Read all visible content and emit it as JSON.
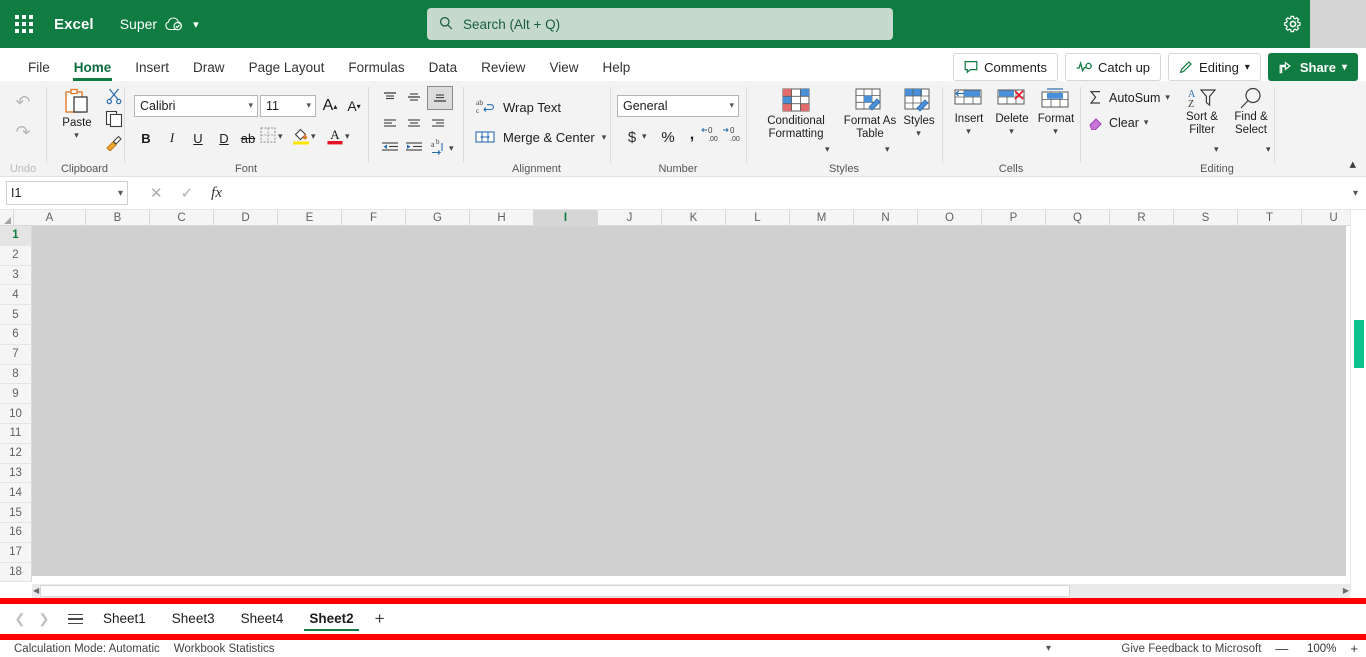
{
  "titlebar": {
    "app_name": "Excel",
    "doc_name": "Super",
    "saved_icon": "cloud-saved-icon",
    "waffle_icon": "app-launcher-icon",
    "gear_icon": "settings-gear-icon",
    "chevron_icon": "chevron-down-icon"
  },
  "search": {
    "placeholder": "Search (Alt + Q)",
    "icon": "search-icon"
  },
  "header_actions": [
    {
      "label": "Comments",
      "icon": "comment-bubble-icon",
      "has_chevron": false,
      "primary": false
    },
    {
      "label": "Catch up",
      "icon": "activity-line-icon",
      "has_chevron": false,
      "primary": false
    },
    {
      "label": "Editing",
      "icon": "pencil-icon",
      "has_chevron": true,
      "primary": false
    },
    {
      "label": "Share",
      "icon": "share-arrow-icon",
      "has_chevron": true,
      "primary": true
    }
  ],
  "ribbon_tabs": [
    {
      "label": "File",
      "active": false
    },
    {
      "label": "Home",
      "active": true
    },
    {
      "label": "Insert",
      "active": false
    },
    {
      "label": "Draw",
      "active": false
    },
    {
      "label": "Page Layout",
      "active": false
    },
    {
      "label": "Formulas",
      "active": false
    },
    {
      "label": "Data",
      "active": false
    },
    {
      "label": "Review",
      "active": false
    },
    {
      "label": "View",
      "active": false
    },
    {
      "label": "Help",
      "active": false
    }
  ],
  "ribbon": {
    "groups": {
      "undo": {
        "label": "Undo",
        "buttons": [
          "undo-arrow-icon",
          "redo-arrow-icon"
        ]
      },
      "clipboard": {
        "label": "Clipboard",
        "paste_label": "Paste",
        "cut_label": "Cut",
        "copy_label": "Copy",
        "format_painter_label": "Format Painter"
      },
      "font": {
        "label": "Font",
        "font_name": "Calibri",
        "font_size": "11",
        "grow_font": "A",
        "shrink_font": "A",
        "bold": "B",
        "italic": "I",
        "underline": "U",
        "double_underline": "D",
        "strikethrough": "ab",
        "borders_label": "Borders",
        "fill_color_label": "Fill Color",
        "font_color_label": "Font Color"
      },
      "alignment": {
        "label": "Alignment",
        "wrap_text": "Wrap Text",
        "merge_center": "Merge & Center",
        "top_align": "Top Align",
        "middle_align": "Middle Align",
        "bottom_align": "Bottom Align",
        "align_left": "Align Left",
        "align_center": "Center",
        "align_right": "Align Right",
        "decrease_indent": "Decrease Indent",
        "increase_indent": "Increase Indent",
        "orientation": "Orientation"
      },
      "number": {
        "label": "Number",
        "format": "General",
        "accounting": "$",
        "percent": "%",
        "comma": ",",
        "decrease_decimal": "Decrease Decimal",
        "increase_decimal": "Increase Decimal"
      },
      "styles": {
        "label": "Styles",
        "conditional_formatting": "Conditional Formatting",
        "format_as_table": "Format As Table",
        "styles": "Styles"
      },
      "cells": {
        "label": "Cells",
        "insert": "Insert",
        "delete": "Delete",
        "format": "Format"
      },
      "editing": {
        "label": "Editing",
        "autosum": "AutoSum",
        "clear": "Clear",
        "sort_filter": "Sort & Filter",
        "find_select": "Find & Select"
      }
    },
    "collapse_icon": "chevron-up-icon"
  },
  "formula_bar": {
    "name_box_value": "I1",
    "cancel_icon": "cancel-x-icon",
    "enter_icon": "confirm-check-icon",
    "fx_icon": "fx-function-icon",
    "formula_value": "",
    "expand_icon": "chevron-down-icon"
  },
  "grid": {
    "columns": [
      "A",
      "B",
      "C",
      "D",
      "E",
      "F",
      "G",
      "H",
      "I",
      "J",
      "K",
      "L",
      "M",
      "N",
      "O",
      "P",
      "Q",
      "R",
      "S",
      "T",
      "U"
    ],
    "selected_column": "I",
    "rows": [
      "1",
      "2",
      "3",
      "4",
      "5",
      "6",
      "7",
      "8",
      "9",
      "10",
      "11",
      "12",
      "13",
      "14",
      "15",
      "16",
      "17",
      "18"
    ],
    "selected_row": "1",
    "active_cell": "I1",
    "scrollbar_thumb_color": "#0cc18c"
  },
  "sheet_tabs": {
    "prev_icon": "chevron-left-icon",
    "next_icon": "chevron-right-icon",
    "all_sheets_icon": "all-sheets-menu-icon",
    "tabs": [
      {
        "label": "Sheet1",
        "active": false
      },
      {
        "label": "Sheet3",
        "active": false
      },
      {
        "label": "Sheet4",
        "active": false
      },
      {
        "label": "Sheet2",
        "active": true
      }
    ],
    "add_label": "+"
  },
  "status_bar": {
    "calculation_mode": "Calculation Mode: Automatic",
    "workbook_statistics": "Workbook Statistics",
    "expand_icon": "chevron-down-icon",
    "feedback": "Give Feedback to Microsoft",
    "zoom_out": "—",
    "zoom_level": "100%",
    "zoom_in": "+"
  },
  "annotation": {
    "highlight_color": "#ff0000"
  }
}
